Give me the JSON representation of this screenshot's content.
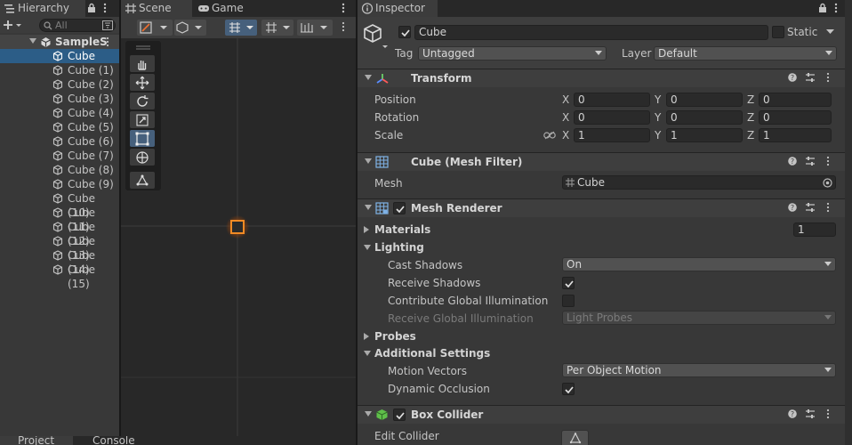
{
  "hierarchy": {
    "tab_label": "Hierarchy",
    "search_placeholder": "All",
    "scene_name": "SampleS",
    "items": [
      "Cube",
      "Cube (1)",
      "Cube (2)",
      "Cube (3)",
      "Cube (4)",
      "Cube (5)",
      "Cube (6)",
      "Cube (7)",
      "Cube (8)",
      "Cube (9)",
      "Cube (10)",
      "Cube (11)",
      "Cube (12)",
      "Cube (13)",
      "Cube (14)",
      "Cube (15)"
    ],
    "selected_index": 0
  },
  "scene_view": {
    "tabs": [
      {
        "label": "Scene",
        "icon": "grid-icon"
      },
      {
        "label": "Game",
        "icon": "gamepad-icon"
      }
    ],
    "active_tab": "Scene",
    "tools": [
      "hand-tool-icon",
      "move-tool-icon",
      "rotate-tool-icon",
      "scale-tool-icon",
      "rect-tool-icon",
      "transform-tool-icon",
      "custom-tool-icon"
    ],
    "active_tool": "rect-tool-icon"
  },
  "bottom": {
    "tabs": [
      "Project",
      "Console"
    ]
  },
  "inspector": {
    "tab_label": "Inspector",
    "object_name": "Cube",
    "active": true,
    "static_label": "Static",
    "static_checked": false,
    "tag_label": "Tag",
    "tag_value": "Untagged",
    "layer_label": "Layer",
    "layer_value": "Default",
    "transform": {
      "title": "Transform",
      "rows": [
        {
          "label": "Position",
          "x": "0",
          "y": "0",
          "z": "0"
        },
        {
          "label": "Rotation",
          "x": "0",
          "y": "0",
          "z": "0"
        },
        {
          "label": "Scale",
          "x": "1",
          "y": "1",
          "z": "1"
        }
      ],
      "axis_labels": [
        "X",
        "Y",
        "Z"
      ]
    },
    "mesh_filter": {
      "title": "Cube (Mesh Filter)",
      "mesh_label": "Mesh",
      "mesh_value": "Cube"
    },
    "mesh_renderer": {
      "title": "Mesh Renderer",
      "enabled": true,
      "materials_label": "Materials",
      "materials_count": "1",
      "lighting_label": "Lighting",
      "cast_shadows_label": "Cast Shadows",
      "cast_shadows_value": "On",
      "receive_shadows_label": "Receive Shadows",
      "receive_shadows": true,
      "contribute_gi_label": "Contribute Global Illumination",
      "contribute_gi": false,
      "receive_gi_label": "Receive Global Illumination",
      "receive_gi_value": "Light Probes",
      "probes_label": "Probes",
      "additional_label": "Additional Settings",
      "motion_vectors_label": "Motion Vectors",
      "motion_vectors_value": "Per Object Motion",
      "dynamic_occlusion_label": "Dynamic Occlusion",
      "dynamic_occlusion": true
    },
    "box_collider": {
      "title": "Box Collider",
      "enabled": true,
      "edit_collider_label": "Edit Collider"
    }
  },
  "colors": {
    "selection": "#2c5d87",
    "panel": "#383838",
    "scene_bg": "#282828",
    "accent_orange": "#f08a24"
  }
}
